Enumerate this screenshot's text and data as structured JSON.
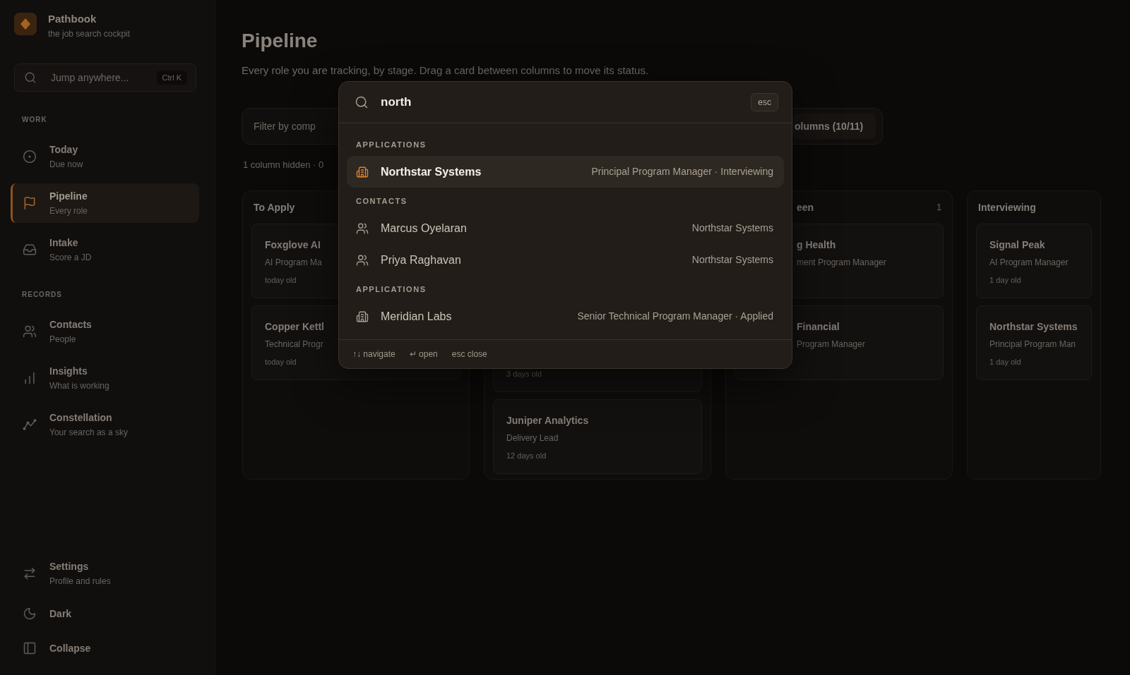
{
  "sidebar": {
    "brand": {
      "name": "Pathbook",
      "tagline": "the job search cockpit"
    },
    "search": {
      "placeholder": "Jump anywhere...",
      "shortcut": "Ctrl K"
    },
    "sections": [
      {
        "label": "WORK",
        "items": [
          {
            "label": "Today",
            "caption": "Due now",
            "selected": false
          },
          {
            "label": "Pipeline",
            "caption": "Every role",
            "selected": true
          },
          {
            "label": "Intake",
            "caption": "Score a JD",
            "selected": false
          }
        ]
      },
      {
        "label": "RECORDS",
        "items": [
          {
            "label": "Contacts",
            "caption": "People",
            "selected": false
          },
          {
            "label": "Insights",
            "caption": "What is working",
            "selected": false
          },
          {
            "label": "Constellation",
            "caption": "Your search as a sky",
            "selected": false
          }
        ]
      }
    ],
    "footer": [
      {
        "label": "Settings",
        "caption": "Profile and rules"
      },
      {
        "label": "Dark"
      },
      {
        "label": "Collapse"
      }
    ]
  },
  "page": {
    "title": "Pipeline",
    "subtitle": "Every role you are tracking, by stage. Drag a card between columns to move its status.",
    "filter": {
      "placeholder": "Filter by comp"
    },
    "columns_button": "olumns (10/11)",
    "note": "1 column hidden · 0"
  },
  "board": {
    "columns": [
      {
        "title": "To Apply",
        "cards": [
          {
            "company": "Foxglove AI",
            "role": "AI Program Ma",
            "age": "today old"
          },
          {
            "company": "Copper Kettl",
            "role": "Technical Progr",
            "age": "today old"
          }
        ]
      },
      {
        "cards": [
          {
            "age": "3 days old"
          },
          {
            "company": "Juniper Analytics",
            "role": "Delivery Lead",
            "age": "12 days old"
          }
        ]
      },
      {
        "title": "een",
        "count": "1",
        "cards": [
          {
            "company": "g Health",
            "role": "ment Program Manager"
          },
          {
            "company": "Financial",
            "role": "Program Manager"
          }
        ]
      },
      {
        "title": "Interviewing",
        "cards": [
          {
            "company": "Signal Peak",
            "role": "AI Program Manager",
            "age": "1 day old"
          },
          {
            "company": "Northstar Systems",
            "role": "Principal Program Man",
            "age": "1 day old"
          }
        ]
      }
    ]
  },
  "command_palette": {
    "query": "north",
    "close_key": "esc",
    "groups": [
      {
        "label": "APPLICATIONS",
        "results": [
          {
            "kind": "application",
            "title": "Northstar Systems",
            "detail": "Principal Program Manager · Interviewing",
            "selected": true
          }
        ]
      },
      {
        "label": "CONTACTS",
        "results": [
          {
            "kind": "contact",
            "title": "Marcus Oyelaran",
            "detail": "Northstar Systems",
            "selected": false
          },
          {
            "kind": "contact",
            "title": "Priya Raghavan",
            "detail": "Northstar Systems",
            "selected": false
          }
        ]
      },
      {
        "label": "APPLICATIONS",
        "results": [
          {
            "kind": "application",
            "title": "Meridian Labs",
            "detail": "Senior Technical Program Manager · Applied",
            "selected": false
          }
        ]
      }
    ],
    "hints": [
      "↑↓ navigate",
      "↵ open",
      "esc close"
    ]
  }
}
